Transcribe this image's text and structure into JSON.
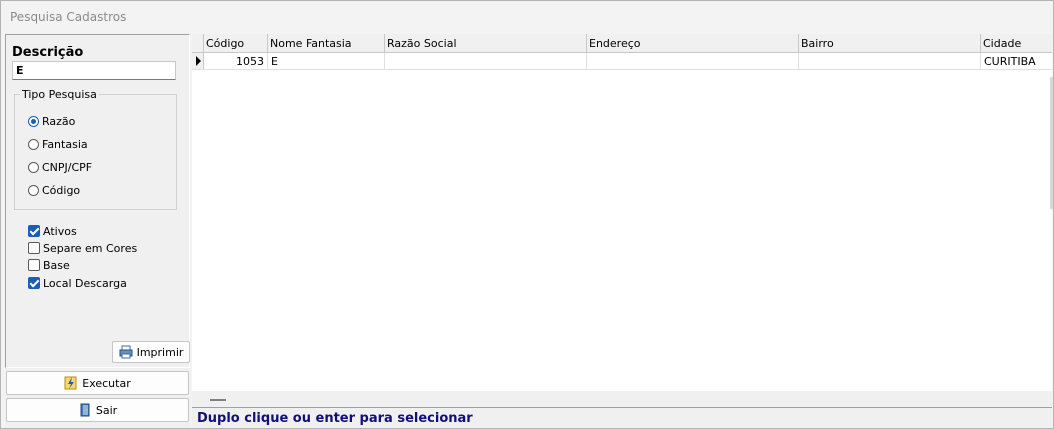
{
  "window": {
    "title": "Pesquisa Cadastros"
  },
  "search": {
    "label": "Descrição",
    "value": "E"
  },
  "tipo_pesquisa": {
    "label": "Tipo Pesquisa",
    "options": [
      {
        "label": "Razão",
        "checked": true
      },
      {
        "label": "Fantasia",
        "checked": false
      },
      {
        "label": "CNPJ/CPF",
        "checked": false
      },
      {
        "label": "Código",
        "checked": false
      }
    ]
  },
  "filters": [
    {
      "label": "Ativos",
      "checked": true
    },
    {
      "label": "Separe em Cores",
      "checked": false
    },
    {
      "label": "Base",
      "checked": false
    },
    {
      "label": "Local Descarga",
      "checked": true
    }
  ],
  "buttons": {
    "imprimir": "Imprimir",
    "executar": "Executar",
    "sair": "Sair"
  },
  "grid": {
    "columns": [
      "Código",
      "Nome Fantasia",
      "Razão Social",
      "Endereço",
      "Bairro",
      "Cidade"
    ],
    "rows": [
      {
        "codigo": "1053",
        "nome_fantasia": "E",
        "razao_social": "",
        "endereco": "",
        "bairro": "",
        "cidade": "CURITIBA"
      }
    ]
  },
  "status": {
    "text": "Duplo clique ou enter para selecionar"
  }
}
